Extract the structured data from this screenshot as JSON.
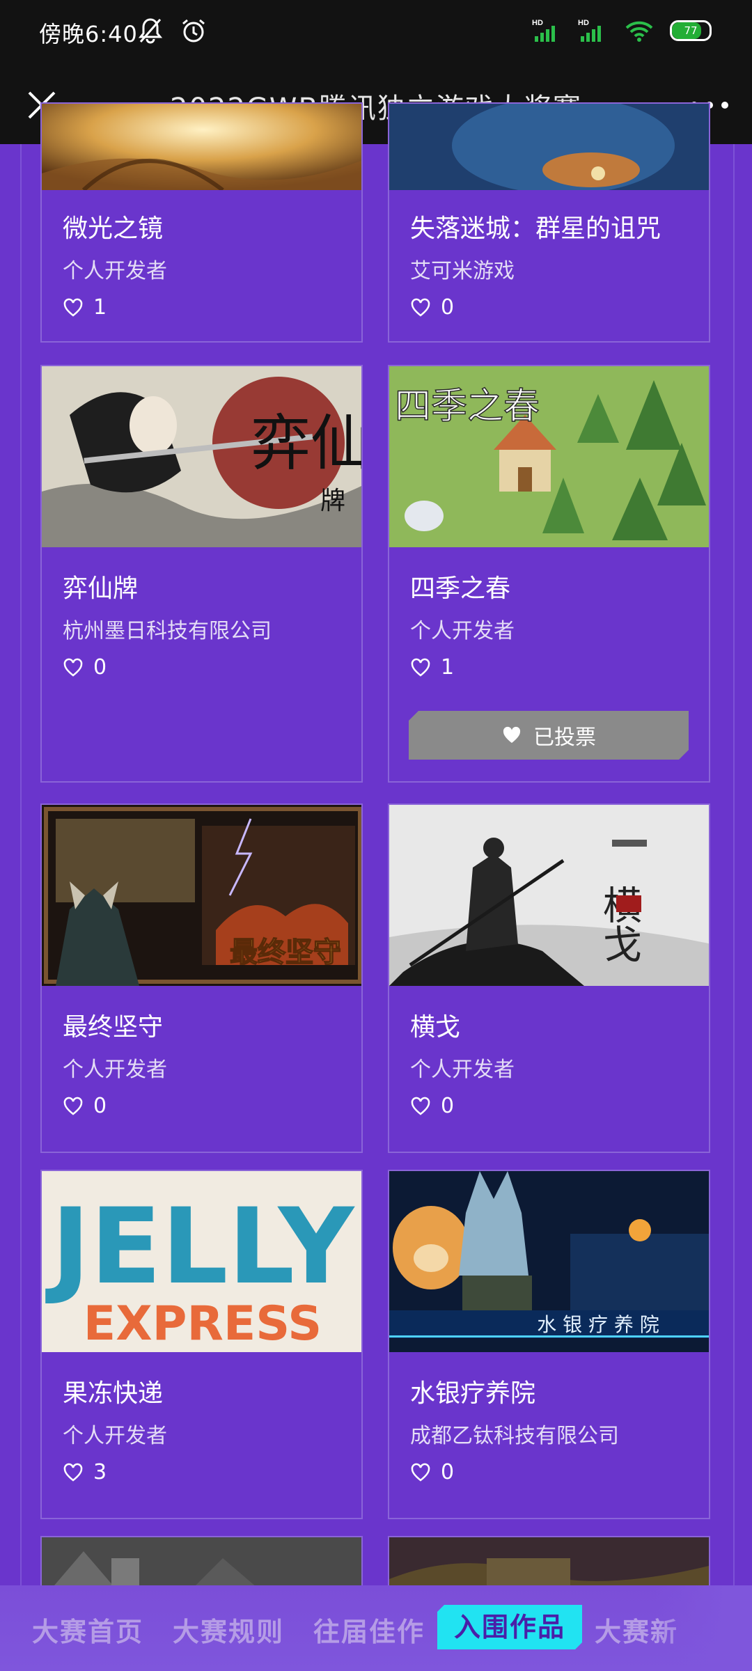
{
  "status_bar": {
    "time": "傍晚6:40",
    "battery": "77",
    "battery_level": 0.77
  },
  "header": {
    "title": "2022GWB腾讯独立游戏大奖赛"
  },
  "games": [
    {
      "title": "微光之镜",
      "developer": "个人开发者",
      "likes": "1"
    },
    {
      "title": "失落迷城：群星的诅咒",
      "developer": "艾可米游戏",
      "likes": "0"
    },
    {
      "title": "弈仙牌",
      "developer": "杭州墨日科技有限公司",
      "likes": "0",
      "art_text": "弈仙",
      "art_sub": "牌"
    },
    {
      "title": "四季之春",
      "developer": "个人开发者",
      "likes": "1",
      "vote_label": "已投票",
      "art_text": "四季之春"
    },
    {
      "title": "最终坚守",
      "developer": "个人开发者",
      "likes": "0",
      "art_text": "最终坚守"
    },
    {
      "title": "横戈",
      "developer": "个人开发者",
      "likes": "0",
      "art_text": "横戈"
    },
    {
      "title": "果冻快递",
      "developer": "个人开发者",
      "likes": "3",
      "art_text": "JELLY",
      "art_sub": "EXPRESS"
    },
    {
      "title": "水银疗养院",
      "developer": "成都乙钛科技有限公司",
      "likes": "0",
      "art_text": "水 银 疗 养 院"
    }
  ],
  "bottom_nav": {
    "tabs": [
      "大赛首页",
      "大赛规则",
      "往届佳作",
      "入围作品",
      "大赛新"
    ],
    "active": "入围作品"
  }
}
